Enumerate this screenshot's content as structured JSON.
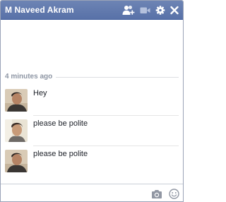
{
  "chat": {
    "title": "M Naveed Akram",
    "header_icons": [
      "add-friend-icon",
      "video-camera-icon",
      "gear-icon",
      "close-icon"
    ],
    "timestamp": "4 minutes ago",
    "messages": [
      {
        "text": "Hey",
        "avatar": "sender-photo-1"
      },
      {
        "text": "please be polite",
        "avatar": "sender-photo-2"
      },
      {
        "text": "please be polite",
        "avatar": "sender-photo-3"
      }
    ],
    "composer": {
      "placeholder": "",
      "icons": [
        "camera-icon",
        "emoji-icon"
      ]
    }
  },
  "colors": {
    "header": "#5871a8",
    "header_border": "#3b5998",
    "timestamp": "#8e96a4",
    "text": "#1d2129"
  }
}
